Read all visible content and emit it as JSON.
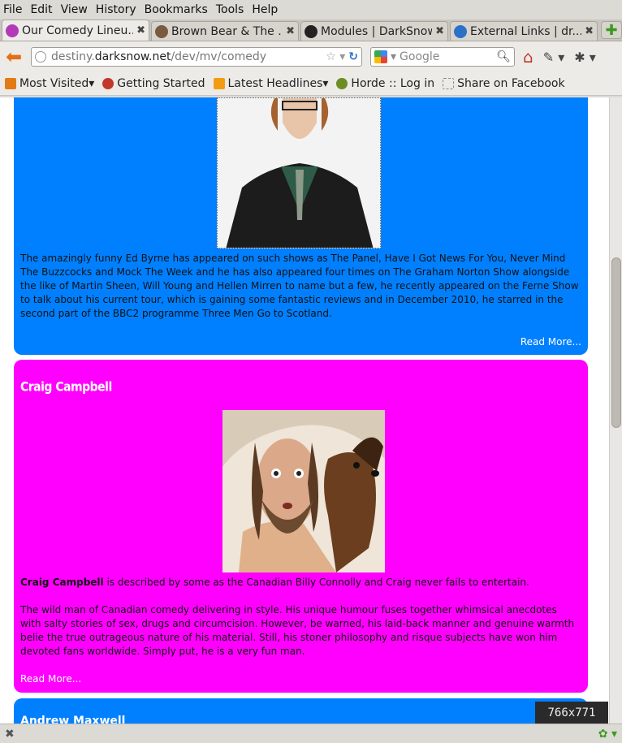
{
  "menu": [
    "File",
    "Edit",
    "View",
    "History",
    "Bookmarks",
    "Tools",
    "Help"
  ],
  "tabs": [
    {
      "label": "Our Comedy Lineu...",
      "icon": "darksnow-pink-icon",
      "color": "#b23ab8",
      "active": true
    },
    {
      "label": "Brown Bear & The ...",
      "icon": "bear-icon",
      "color": "#7a5a40",
      "active": false
    },
    {
      "label": "Modules | DarkSnow",
      "icon": "darksnow-icon",
      "color": "#222222",
      "active": false
    },
    {
      "label": "External Links | dr...",
      "icon": "drupal-icon",
      "color": "#2d70c8",
      "active": false
    }
  ],
  "nav": {
    "url_prefix": "destiny.",
    "url_domain": "darksnow.net",
    "url_path": "/dev/mv/comedy",
    "search_placeholder": "Google"
  },
  "bookmarks": [
    {
      "label": "Most Visited",
      "icon": "most-visited-icon",
      "color": "#e07b16",
      "dropdown": "▾"
    },
    {
      "label": "Getting Started",
      "icon": "firefox-icon",
      "color": "#c0392b",
      "dropdown": ""
    },
    {
      "label": "Latest Headlines",
      "icon": "rss-icon",
      "color": "#f39c12",
      "dropdown": "▾"
    },
    {
      "label": "Horde :: Log in",
      "icon": "horde-icon",
      "color": "#6b8e23",
      "dropdown": ""
    },
    {
      "label": "Share on Facebook",
      "icon": "bookmark-icon",
      "color": "#999999",
      "dropdown": ""
    }
  ],
  "content": {
    "ed": {
      "text": "The amazingly funny Ed Byrne has appeared on such shows as The Panel, Have I Got News For You, Never Mind The Buzzcocks and Mock The Week and he has also appeared four times on The Graham Norton Show alongside the like of Martin Sheen, Will Young and Hellen Mirren to name but a few, he recently appeared on the Ferne Show to talk about his current tour, which is gaining some fantastic reviews and in December 2010, he starred in the second part of the BBC2 programme Three Men Go to Scotland.",
      "read_more": "Read More..."
    },
    "craig": {
      "title": "Craig Campbell",
      "intro_bold": "Craig Campbell",
      "intro_rest": " is described by some as the Canadian Billy Connolly and Craig never fails to entertain.",
      "text": "The wild man of Canadian comedy delivering in style. His unique humour fuses together whimsical anecdotes with salty stories of sex, drugs and circumcision. However, be warned, his laid-back manner and genuine warmth belie the true outrageous nature of his material. Still, his stoner philosophy and risque subjects have won him devoted fans worldwide. Simply put, he is a very fun man.",
      "read_more": "Read More..."
    },
    "next_title": "Andrew Maxwell"
  },
  "viewport_size": "766x771",
  "colors": {
    "blue_panel": "#0080ff",
    "pink_panel": "#ff00ff"
  }
}
